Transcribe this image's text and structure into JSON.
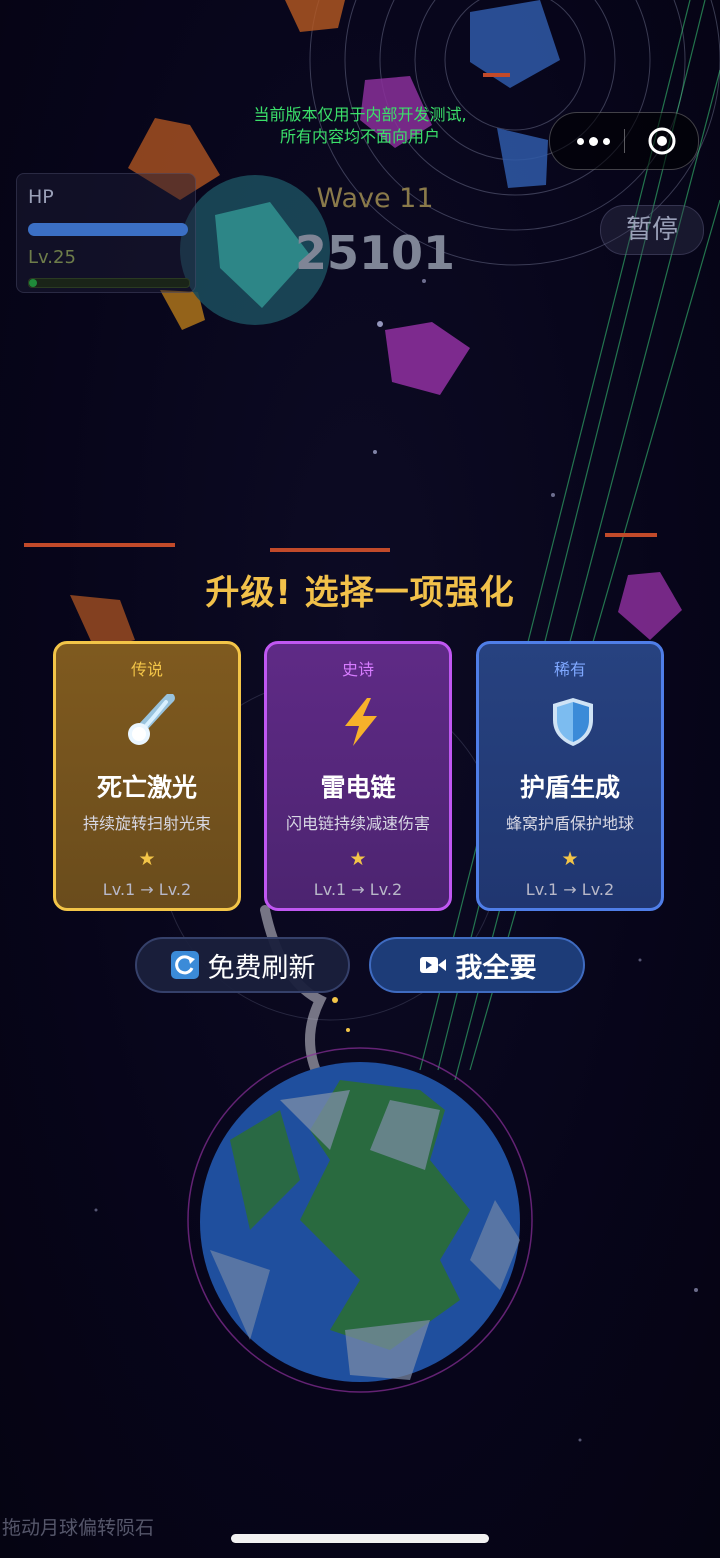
{
  "notice": {
    "line1": "当前版本仅用于内部开发测试,",
    "line2": "所有内容均不面向用户"
  },
  "hud": {
    "hp_label": "HP",
    "hp_fraction": 1.0,
    "level_label": "Lv.25",
    "xp_fraction": 0.05,
    "wave_label": "Wave 11",
    "score": "25101",
    "pause_label": "暂停"
  },
  "upgrade": {
    "title": "升级! 选择一项强化",
    "cards": [
      {
        "rarity": "传说",
        "icon": "meteor-icon",
        "name": "死亡激光",
        "description": "持续旋转扫射光束",
        "stars": "★",
        "level": "Lv.1 → Lv.2",
        "color": "#f3c548"
      },
      {
        "rarity": "史诗",
        "icon": "lightning-icon",
        "name": "雷电链",
        "description": "闪电链持续减速伤害",
        "stars": "★",
        "level": "Lv.1 → Lv.2",
        "color": "#c057f2"
      },
      {
        "rarity": "稀有",
        "icon": "shield-icon",
        "name": "护盾生成",
        "description": "蜂窝护盾保护地球",
        "stars": "★",
        "level": "Lv.1 → Lv.2",
        "color": "#4f7ee8"
      }
    ],
    "refresh_label": "免费刷新",
    "take_all_label": "我全要"
  },
  "hint": "拖动月球偏转陨石",
  "colors": {
    "background": "#080614",
    "gold": "#f2c14a",
    "notice_green": "#3be06a"
  }
}
